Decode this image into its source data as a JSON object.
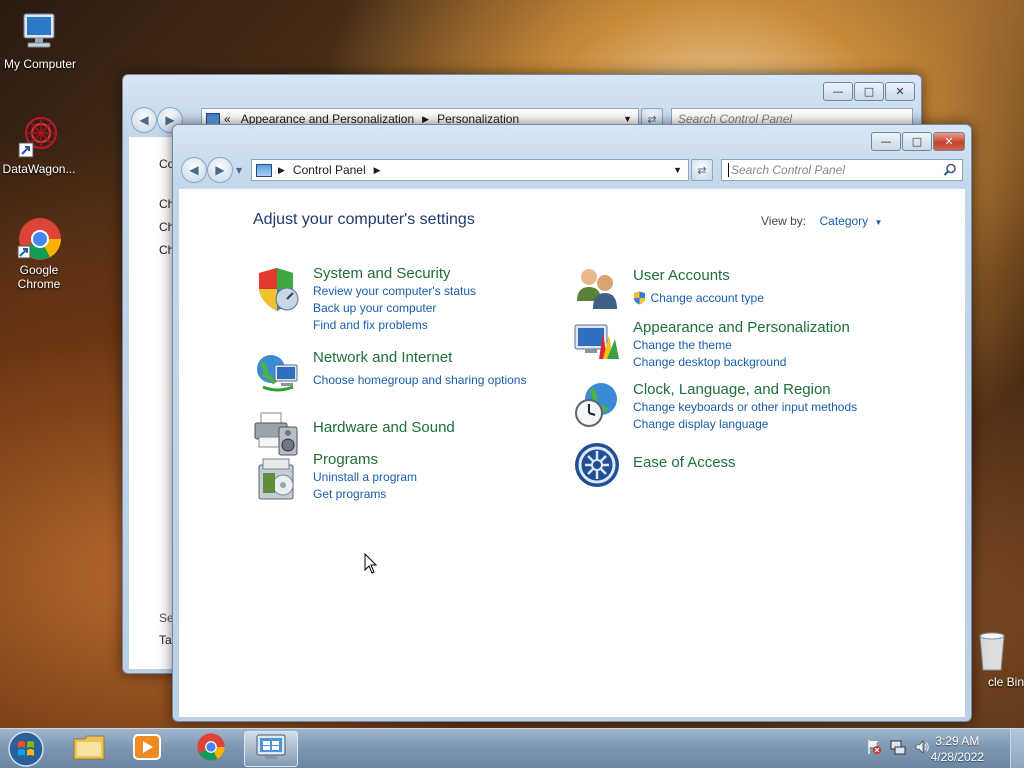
{
  "desktop": {
    "icons": [
      {
        "label": "My Computer"
      },
      {
        "label": "DataWagon..."
      },
      {
        "label": "Google Chrome"
      },
      {
        "label": "cle Bin"
      }
    ]
  },
  "back_window": {
    "breadcrumb_parent": "Appearance and Personalization",
    "breadcrumb_current": "Personalization",
    "search_placeholder": "Search Control Panel",
    "left_text": [
      "Co",
      "Ch",
      "Ch",
      "Ch",
      "Se",
      "Ta"
    ]
  },
  "front_window": {
    "address": "Control Panel",
    "search_placeholder": "Search Control Panel",
    "heading": "Adjust your computer's settings",
    "view_by_label": "View by:",
    "view_by_value": "Category",
    "categories_left": [
      {
        "title": "System and Security",
        "links": [
          "Review your computer's status",
          "Back up your computer",
          "Find and fix problems"
        ],
        "icon": "shield-icon"
      },
      {
        "title": "Network and Internet",
        "links": [
          "Choose homegroup and sharing options"
        ],
        "icon": "network-globe-icon"
      },
      {
        "title": "Hardware and Sound",
        "links": [],
        "icon": "printer-speaker-icon"
      },
      {
        "title": "Programs",
        "links": [
          "Uninstall a program",
          "Get programs"
        ],
        "icon": "programs-icon"
      }
    ],
    "categories_right": [
      {
        "title": "User Accounts",
        "links": [
          "Change account type"
        ],
        "icon": "users-icon"
      },
      {
        "title": "Appearance and Personalization",
        "links": [
          "Change the theme",
          "Change desktop background"
        ],
        "icon": "monitor-palette-icon"
      },
      {
        "title": "Clock, Language, and Region",
        "links": [
          "Change keyboards or other input methods",
          "Change display language"
        ],
        "icon": "clock-globe-icon"
      },
      {
        "title": "Ease of Access",
        "links": [],
        "icon": "ease-of-access-icon"
      }
    ]
  },
  "taskbar": {
    "time": "3:29 AM",
    "date": "4/28/2022"
  }
}
